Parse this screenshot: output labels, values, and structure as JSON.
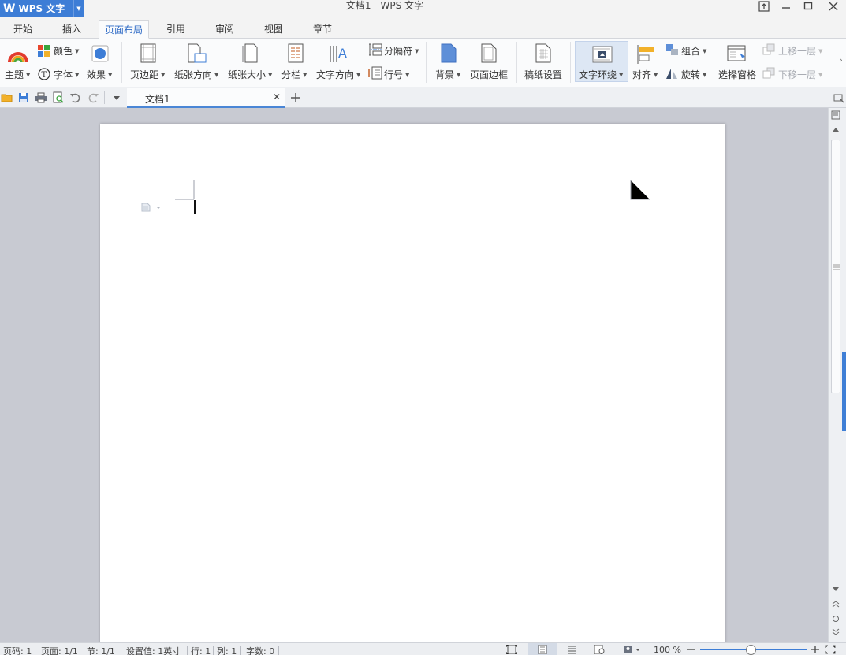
{
  "app": {
    "logo_text": "WPS 文字",
    "window_title": "文档1 - WPS 文字"
  },
  "tabs": [
    "开始",
    "插入",
    "页面布局",
    "引用",
    "审阅",
    "视图",
    "章节"
  ],
  "active_tab": "页面布局",
  "ribbon": {
    "theme": "主题",
    "color": "颜色",
    "font": "字体",
    "effect": "效果",
    "margins": "页边距",
    "orientation": "纸张方向",
    "paper_size": "纸张大小",
    "columns": "分栏",
    "text_direction": "文字方向",
    "separator": "分隔符",
    "line_numbers": "行号",
    "background": "背景",
    "page_border": "页面边框",
    "manuscript": "稿纸设置",
    "text_wrap": "文字环绕",
    "align": "对齐",
    "group": "组合",
    "rotate": "旋转",
    "selection_pane": "选择窗格",
    "bring_forward": "上移一层",
    "send_backward": "下移一层"
  },
  "document_tab": {
    "name": "文档1"
  },
  "status": {
    "page_num": "页码: 1",
    "pages": "页面: 1/1",
    "section": "节: 1/1",
    "setting": "设置值: 1英寸",
    "row": "行: 1",
    "col": "列: 1",
    "words": "字数: 0",
    "zoom": "100 %",
    "zoom_level_fraction": 0.48
  },
  "colors": {
    "accent": "#3d7dd6",
    "active_tab_text": "#2f6bc6"
  }
}
